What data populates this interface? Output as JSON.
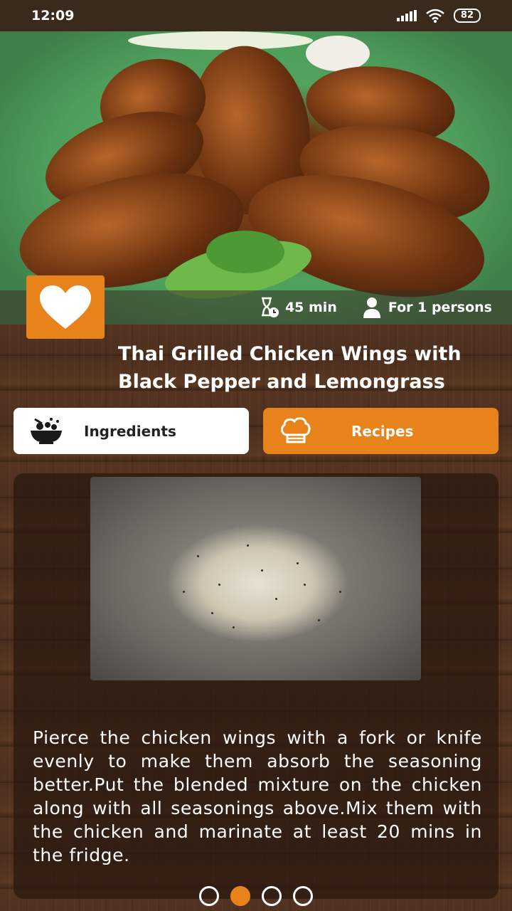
{
  "status_bar": {
    "time": "12:09",
    "battery": "82"
  },
  "recipe": {
    "cook_time": "45 min",
    "servings": "For 1 persons",
    "title": "Thai Grilled Chicken Wings with Black Pepper and Lemongrass"
  },
  "tabs": [
    {
      "label": "Ingredients",
      "icon": "food-bowl-icon",
      "active": false
    },
    {
      "label": "Recipes",
      "icon": "chef-hat-icon",
      "active": true
    }
  ],
  "step": {
    "text": "Pierce  the chicken wings with a fork or knife  evenly  to make them absorb the seasoning better.Put the blended mixture on the chicken along with all seasonings above.Mix  them  with  the chicken and marinate at least 20 mins in the fridge."
  },
  "pager": {
    "total": 4,
    "current": 2
  },
  "colors": {
    "accent": "#e8821a",
    "text": "#ffffff"
  }
}
